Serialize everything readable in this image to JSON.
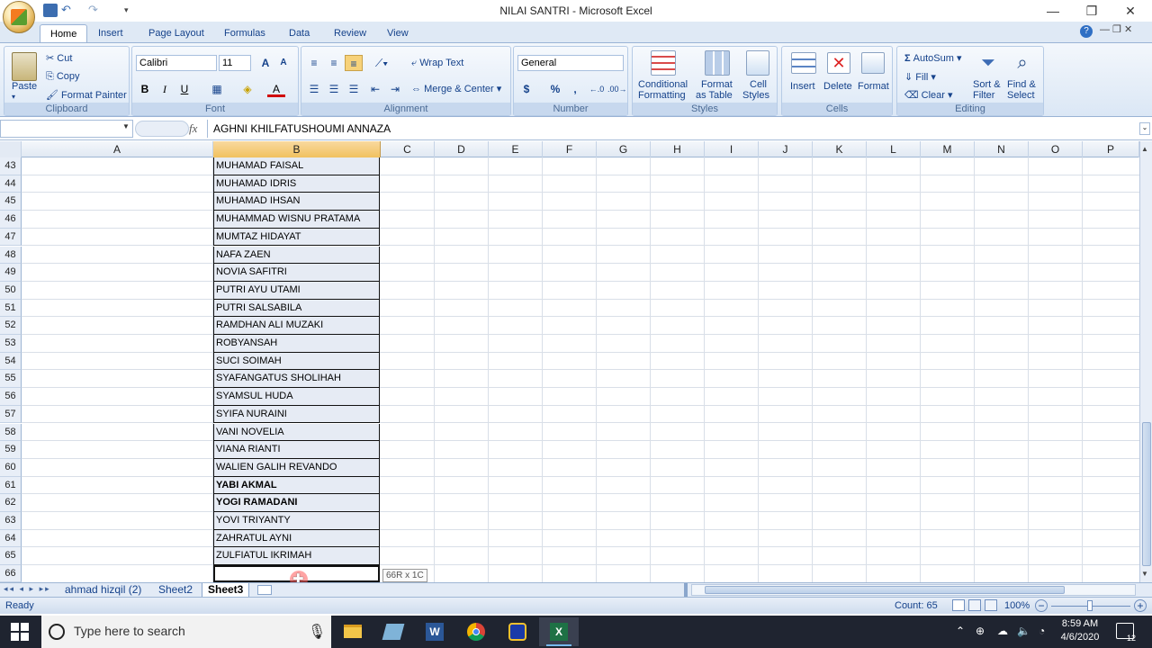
{
  "window": {
    "title": "NILAI SANTRI - Microsoft Excel"
  },
  "tabs": [
    {
      "label": "Home",
      "active": true
    },
    {
      "label": "Insert"
    },
    {
      "label": "Page Layout"
    },
    {
      "label": "Formulas"
    },
    {
      "label": "Data"
    },
    {
      "label": "Review"
    },
    {
      "label": "View"
    }
  ],
  "ribbon": {
    "clipboard": {
      "label": "Clipboard",
      "paste": "Paste",
      "cut": "Cut",
      "copy": "Copy",
      "format_painter": "Format Painter"
    },
    "font": {
      "label": "Font",
      "name": "Calibri",
      "size": "11",
      "bold": "B",
      "italic": "I",
      "underline": "U"
    },
    "alignment": {
      "label": "Alignment",
      "wrap_text": "Wrap Text",
      "merge_center": "Merge & Center"
    },
    "number": {
      "label": "Number",
      "format": "General",
      "currency": "$",
      "percent": "%",
      "comma": ","
    },
    "styles": {
      "label": "Styles",
      "conditional_formatting_1": "Conditional",
      "conditional_formatting_2": "Formatting",
      "format_table_1": "Format",
      "format_table_2": "as Table",
      "cell_styles_1": "Cell",
      "cell_styles_2": "Styles"
    },
    "cells": {
      "label": "Cells",
      "insert": "Insert",
      "delete": "Delete",
      "format": "Format"
    },
    "editing": {
      "label": "Editing",
      "autosum": "AutoSum",
      "fill": "Fill",
      "clear": "Clear",
      "sort_1": "Sort &",
      "sort_2": "Filter",
      "find_1": "Find &",
      "find_2": "Select"
    }
  },
  "formula_bar": {
    "name_box": "",
    "fx": "fx",
    "content": "AGHNI KHILFATUSHOUMI ANNAZA"
  },
  "columns": [
    "A",
    "B",
    "C",
    "D",
    "E",
    "F",
    "G",
    "H",
    "I",
    "J",
    "K",
    "L",
    "M",
    "N",
    "O",
    "P"
  ],
  "rows": [
    {
      "num": "43",
      "b": "MUHAMAD FAISAL"
    },
    {
      "num": "44",
      "b": "MUHAMAD IDRIS"
    },
    {
      "num": "45",
      "b": "MUHAMAD IHSAN"
    },
    {
      "num": "46",
      "b": "MUHAMMAD WISNU PRATAMA"
    },
    {
      "num": "47",
      "b": "MUMTAZ HIDAYAT"
    },
    {
      "num": "48",
      "b": "NAFA ZAEN"
    },
    {
      "num": "49",
      "b": "NOVIA SAFITRI"
    },
    {
      "num": "50",
      "b": "PUTRI AYU UTAMI"
    },
    {
      "num": "51",
      "b": "PUTRI SALSABILA"
    },
    {
      "num": "52",
      "b": "RAMDHAN ALI MUZAKI"
    },
    {
      "num": "53",
      "b": "ROBYANSAH"
    },
    {
      "num": "54",
      "b": "SUCI SOIMAH"
    },
    {
      "num": "55",
      "b": "SYAFANGATUS SHOLIHAH"
    },
    {
      "num": "56",
      "b": "SYAMSUL HUDA"
    },
    {
      "num": "57",
      "b": "SYIFA NURAINI"
    },
    {
      "num": "58",
      "b": "VANI NOVELIA"
    },
    {
      "num": "59",
      "b": "VIANA RIANTI"
    },
    {
      "num": "60",
      "b": "WALIEN GALIH REVANDO"
    },
    {
      "num": "61",
      "b": "YABI AKMAL",
      "bold": true
    },
    {
      "num": "62",
      "b": "YOGI RAMADANI",
      "bold": true
    },
    {
      "num": "63",
      "b": "YOVI TRIYANTY"
    },
    {
      "num": "64",
      "b": "ZAHRATUL AYNI"
    },
    {
      "num": "65",
      "b": "ZULFIATUL IKRIMAH"
    },
    {
      "num": "66",
      "b": ""
    }
  ],
  "selection_tooltip": "66R x 1C",
  "sheets": [
    {
      "label": "ahmad hizqil (2)"
    },
    {
      "label": "Sheet2"
    },
    {
      "label": "Sheet3",
      "active": true
    }
  ],
  "status": {
    "ready": "Ready",
    "count": "Count: 65",
    "zoom": "100%"
  },
  "taskbar": {
    "search_placeholder": "Type here to search",
    "time": "8:59 AM",
    "date": "4/6/2020",
    "notifications": "12"
  },
  "colors": {
    "ribbon_bg": "#dbe7f5",
    "selected_header": "#f1c15f",
    "taskbar": "#1f2430",
    "accent": "#15428b"
  }
}
